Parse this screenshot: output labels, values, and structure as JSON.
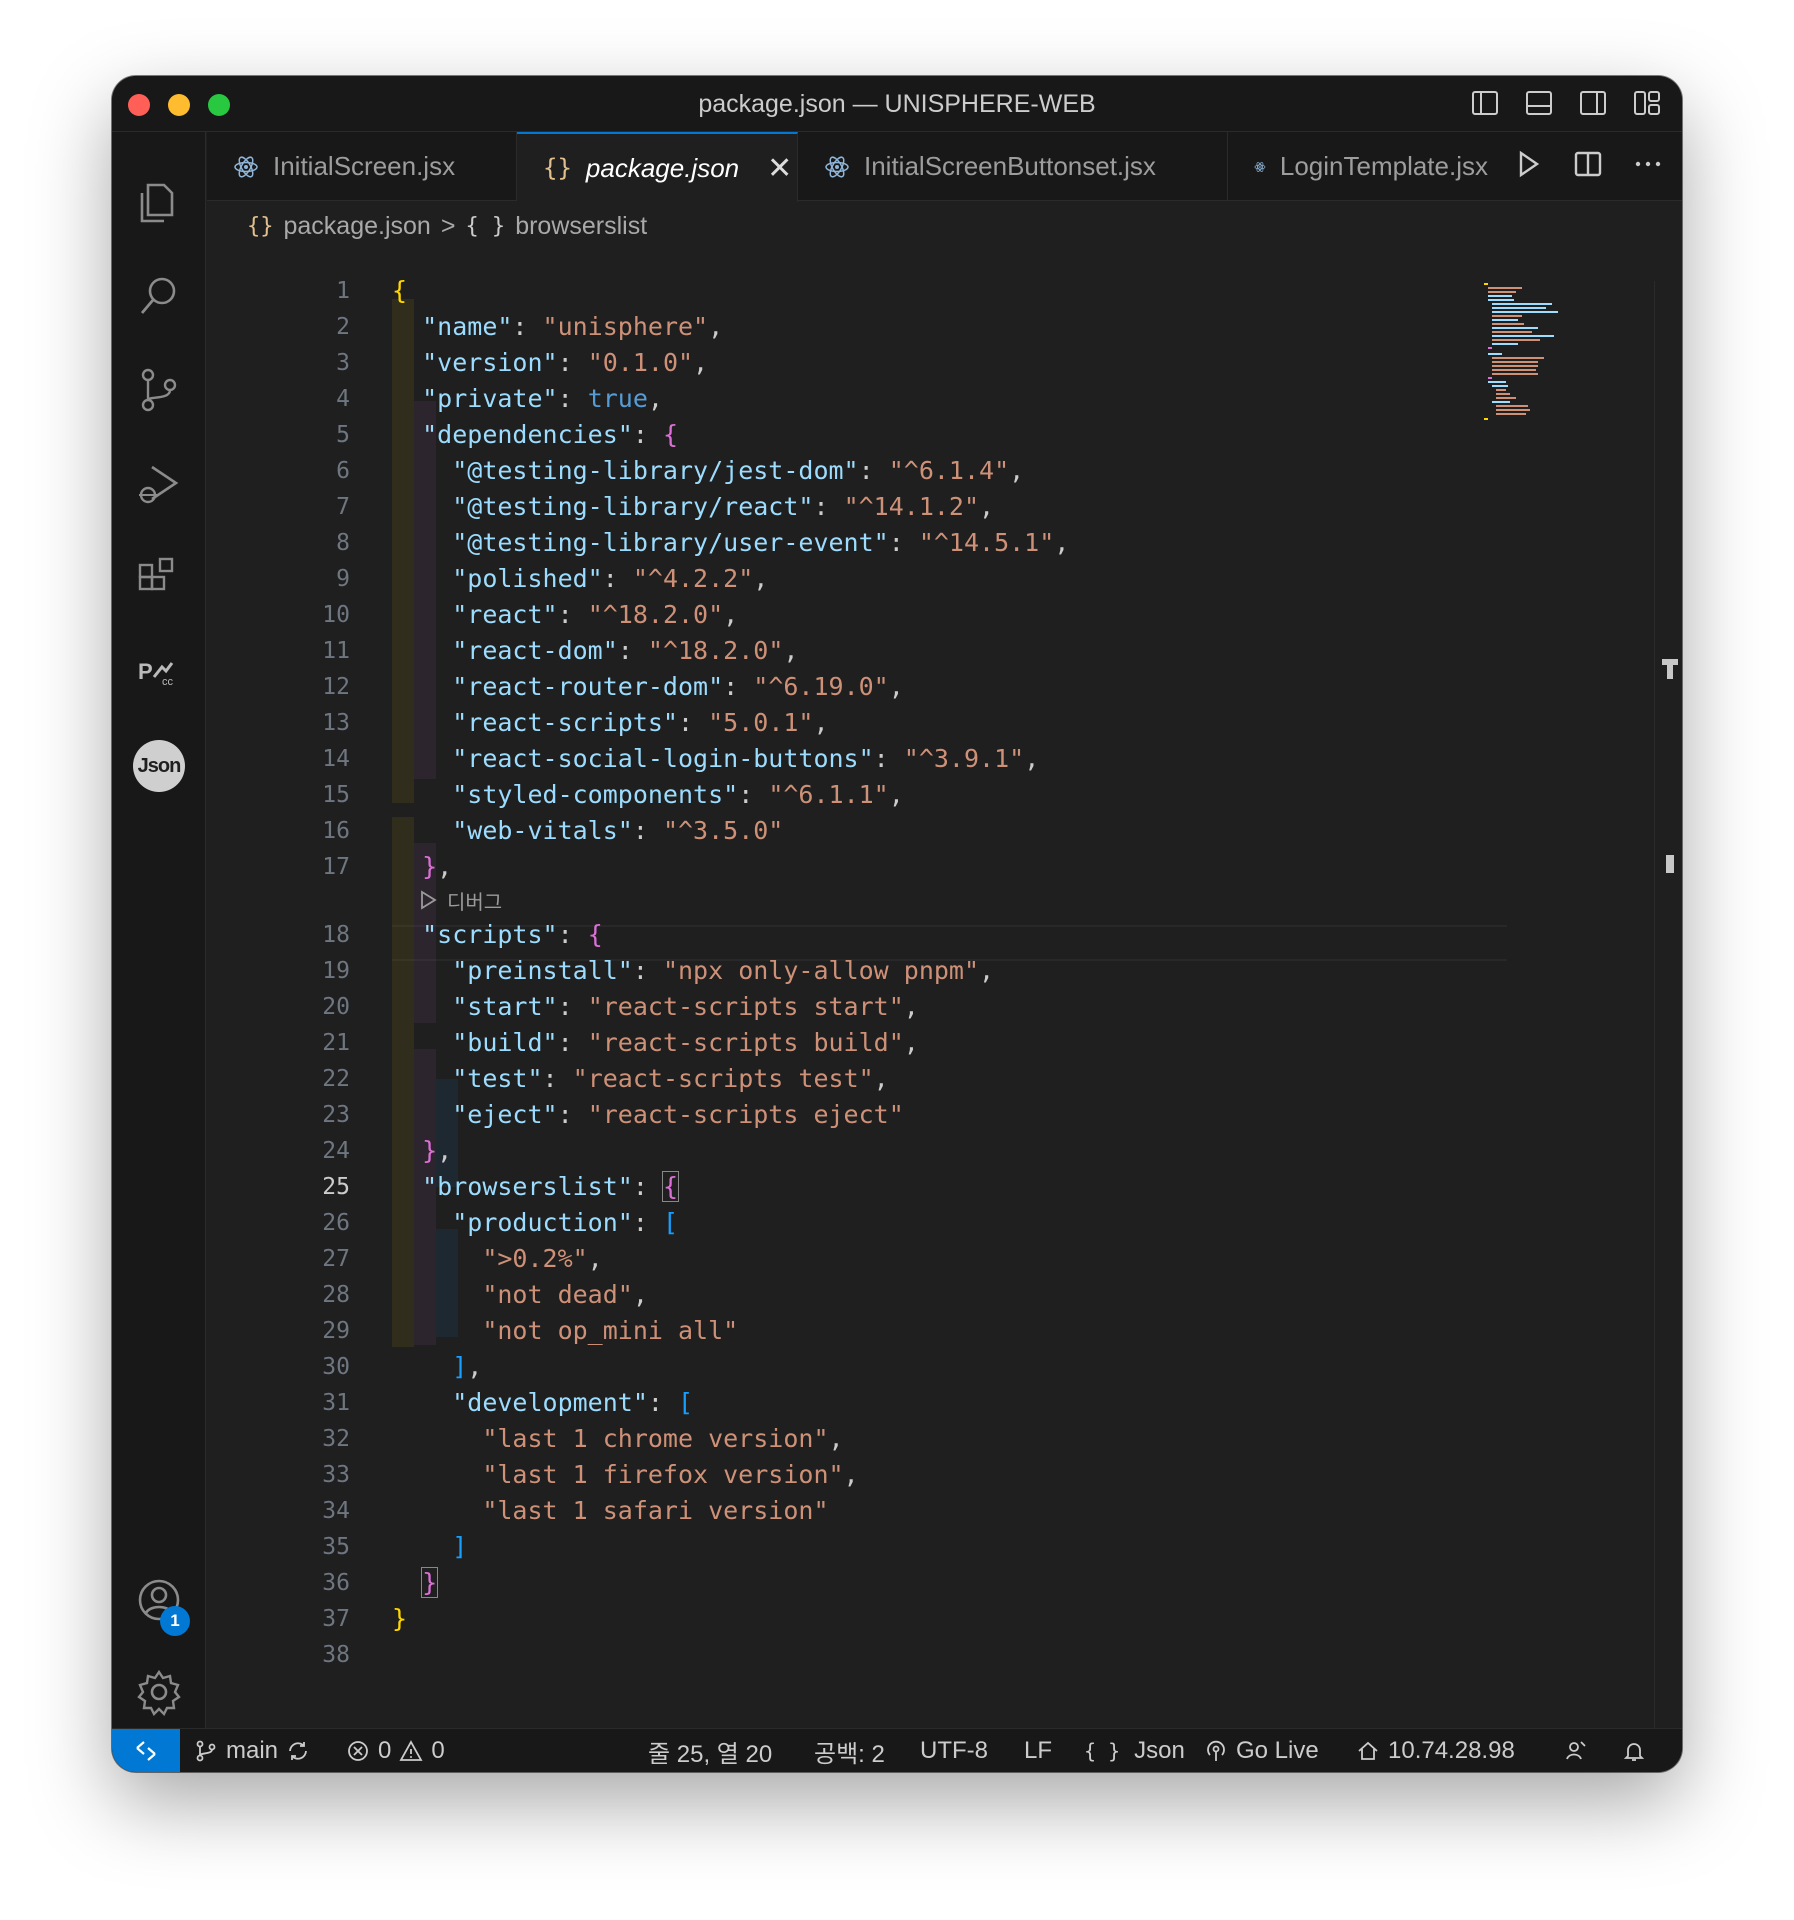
{
  "window": {
    "title": "package.json — UNISPHERE-WEB"
  },
  "activity_bar": {
    "items": [
      "explorer-icon",
      "search-icon",
      "source-control-icon",
      "run-debug-icon",
      "extensions-icon",
      "pscc-icon",
      "json-extension-icon"
    ],
    "json_label": "Json",
    "accounts_badge": "1"
  },
  "tabs": [
    {
      "label": "InitialScreen.jsx",
      "icon": "react-icon",
      "active": false
    },
    {
      "label": "package.json",
      "icon": "json-braces-icon",
      "active": true
    },
    {
      "label": "InitialScreenButtonset.jsx",
      "icon": "react-icon",
      "active": false
    },
    {
      "label": "LoginTemplate.jsx",
      "icon": "react-icon",
      "active": false
    }
  ],
  "breadcrumb": {
    "file_icon": "{}",
    "file": "package.json",
    "sep": ">",
    "symbol_icon": "{ }",
    "symbol": "browserslist"
  },
  "editor": {
    "codelens": "디버그",
    "current_line": 25,
    "line_numbers": [
      "1",
      "2",
      "3",
      "4",
      "5",
      "6",
      "7",
      "8",
      "9",
      "10",
      "11",
      "12",
      "13",
      "14",
      "15",
      "16",
      "17",
      "18",
      "19",
      "20",
      "21",
      "22",
      "23",
      "24",
      "25",
      "26",
      "27",
      "28",
      "29",
      "30",
      "31",
      "32",
      "33",
      "34",
      "35",
      "36",
      "37",
      "38"
    ]
  },
  "code": {
    "l1": "{",
    "name_k": "\"name\"",
    "name_v": "\"unisphere\"",
    "version_k": "\"version\"",
    "version_v": "\"0.1.0\"",
    "private_k": "\"private\"",
    "private_v": "true",
    "deps_k": "\"dependencies\"",
    "d1_k": "\"@testing-library/jest-dom\"",
    "d1_v": "\"^6.1.4\"",
    "d2_k": "\"@testing-library/react\"",
    "d2_v": "\"^14.1.2\"",
    "d3_k": "\"@testing-library/user-event\"",
    "d3_v": "\"^14.5.1\"",
    "d4_k": "\"polished\"",
    "d4_v": "\"^4.2.2\"",
    "d5_k": "\"react\"",
    "d5_v": "\"^18.2.0\"",
    "d6_k": "\"react-dom\"",
    "d6_v": "\"^18.2.0\"",
    "d7_k": "\"react-router-dom\"",
    "d7_v": "\"^6.19.0\"",
    "d8_k": "\"react-scripts\"",
    "d8_v": "\"5.0.1\"",
    "d9_k": "\"react-social-login-buttons\"",
    "d9_v": "\"^3.9.1\"",
    "d10_k": "\"styled-components\"",
    "d10_v": "\"^6.1.1\"",
    "d11_k": "\"web-vitals\"",
    "d11_v": "\"^3.5.0\"",
    "scripts_k": "\"scripts\"",
    "s1_k": "\"preinstall\"",
    "s1_v": "\"npx only-allow pnpm\"",
    "s2_k": "\"start\"",
    "s2_v": "\"react-scripts start\"",
    "s3_k": "\"build\"",
    "s3_v": "\"react-scripts build\"",
    "s4_k": "\"test\"",
    "s4_v": "\"react-scripts test\"",
    "s5_k": "\"eject\"",
    "s5_v": "\"react-scripts eject\"",
    "bl_k": "\"browserslist\"",
    "prod_k": "\"production\"",
    "p1": "\">0.2%\"",
    "p2": "\"not dead\"",
    "p3": "\"not op_mini all\"",
    "dev_k": "\"development\"",
    "v1": "\"last 1 chrome version\"",
    "v2": "\"last 1 firefox version\"",
    "v3": "\"last 1 safari version\""
  },
  "status_bar": {
    "branch": "main",
    "errors": "0",
    "warnings": "0",
    "position": "줄 25, 열 20",
    "spaces": "공백: 2",
    "encoding": "UTF-8",
    "eol": "LF",
    "language_icon": "{ }",
    "language": "Json",
    "go_live": "Go Live",
    "ip": "10.74.28.98"
  },
  "colors": {
    "accent": "#0078d4",
    "string": "#ce9178",
    "key": "#9cdcfe",
    "bool": "#569cd6"
  }
}
